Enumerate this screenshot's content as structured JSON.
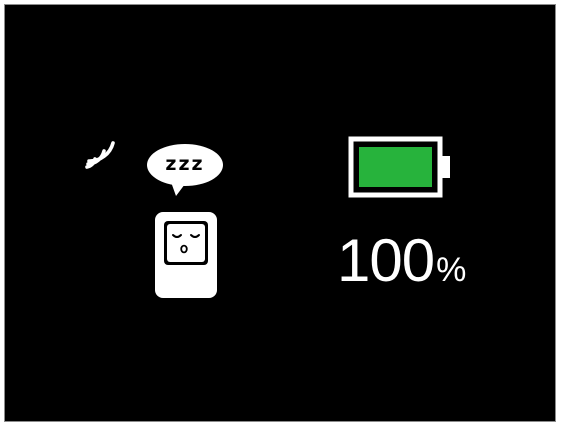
{
  "status": {
    "sleep_text": "zzz",
    "battery_percent": "100",
    "percent_sign": "%",
    "battery_level": 1.0
  },
  "icons": {
    "signal": "signal-waves-icon",
    "speech": "speech-bubble-icon",
    "device": "sleeping-device-icon",
    "battery": "battery-full-icon"
  },
  "colors": {
    "background": "#000000",
    "foreground": "#ffffff",
    "battery_fill": "#27b33c"
  }
}
